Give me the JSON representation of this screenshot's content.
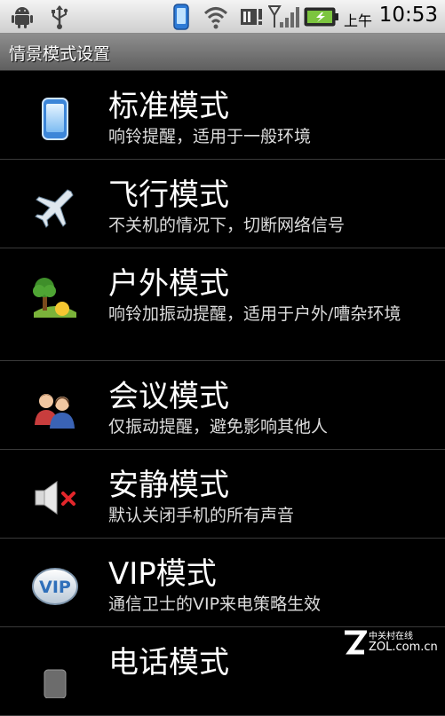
{
  "status_bar": {
    "am_pm": "上午",
    "time": "10:53",
    "left_icons": [
      "android-icon",
      "usb-icon"
    ],
    "right_icons": [
      "phone-icon",
      "wifi-icon",
      "notification-icon",
      "signal-icon",
      "battery-icon"
    ]
  },
  "title_bar": {
    "title": "情景模式设置"
  },
  "modes": [
    {
      "name": "标准模式",
      "description": "响铃提醒，适用于一般环境",
      "icon": "phone-icon"
    },
    {
      "name": "飞行模式",
      "description": "不关机的情况下，切断网络信号",
      "icon": "airplane-icon"
    },
    {
      "name": "户外模式",
      "description": "响铃加振动提醒，适用于户外/嘈杂环境",
      "icon": "outdoor-tree-icon"
    },
    {
      "name": "会议模式",
      "description": "仅振动提醒，避免影响其他人",
      "icon": "meeting-people-icon"
    },
    {
      "name": "安静模式",
      "description": "默认关闭手机的所有声音",
      "icon": "mute-speaker-icon"
    },
    {
      "name": "VIP模式",
      "description": "通信卫士的VIP来电策略生效",
      "icon": "vip-icon"
    },
    {
      "name": "电话模式",
      "description": "",
      "icon": "phone-mode-icon"
    }
  ],
  "watermark": {
    "brand": "中关村在线",
    "url": "ZOL.com.cn"
  }
}
